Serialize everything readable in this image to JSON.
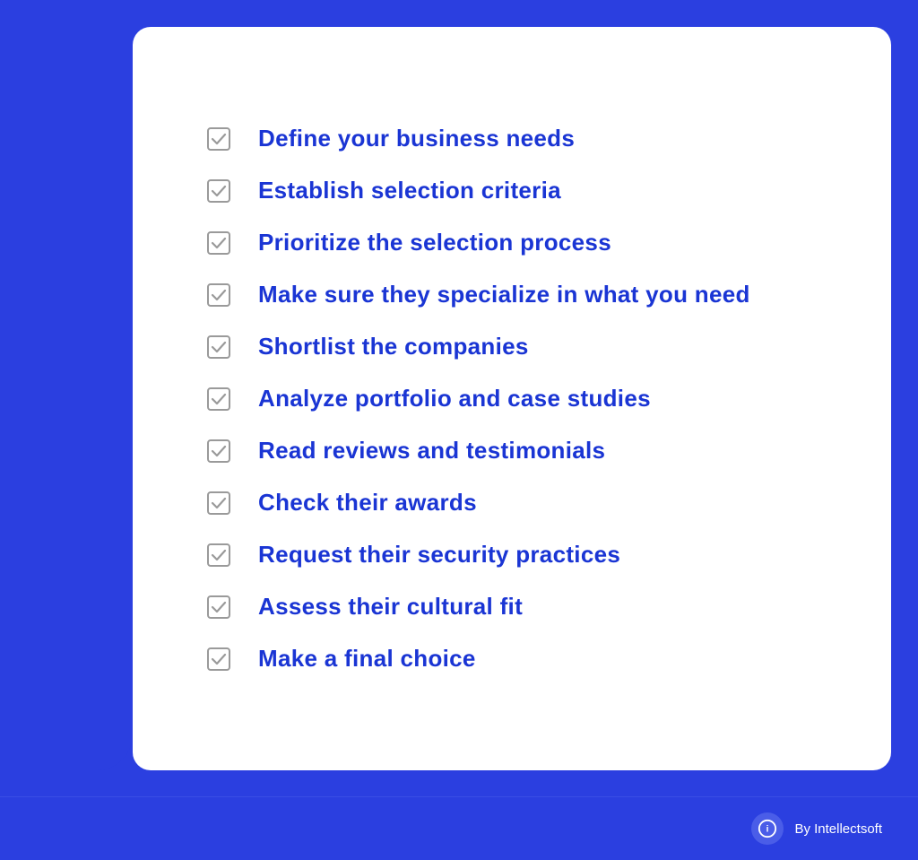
{
  "background_color": "#2B3FE0",
  "card_background": "#ffffff",
  "checklist": {
    "items": [
      {
        "id": 1,
        "label": "Define your business needs"
      },
      {
        "id": 2,
        "label": "Establish selection criteria"
      },
      {
        "id": 3,
        "label": "Prioritize the selection process"
      },
      {
        "id": 4,
        "label": "Make sure they specialize in what you need"
      },
      {
        "id": 5,
        "label": "Shortlist the companies"
      },
      {
        "id": 6,
        "label": "Analyze portfolio and case studies"
      },
      {
        "id": 7,
        "label": "Read reviews and testimonials"
      },
      {
        "id": 8,
        "label": "Check their awards"
      },
      {
        "id": 9,
        "label": "Request their security practices"
      },
      {
        "id": 10,
        "label": "Assess their cultural fit"
      },
      {
        "id": 11,
        "label": "Make a final choice"
      }
    ]
  },
  "footer": {
    "brand_text": "By Intellectsoft"
  }
}
